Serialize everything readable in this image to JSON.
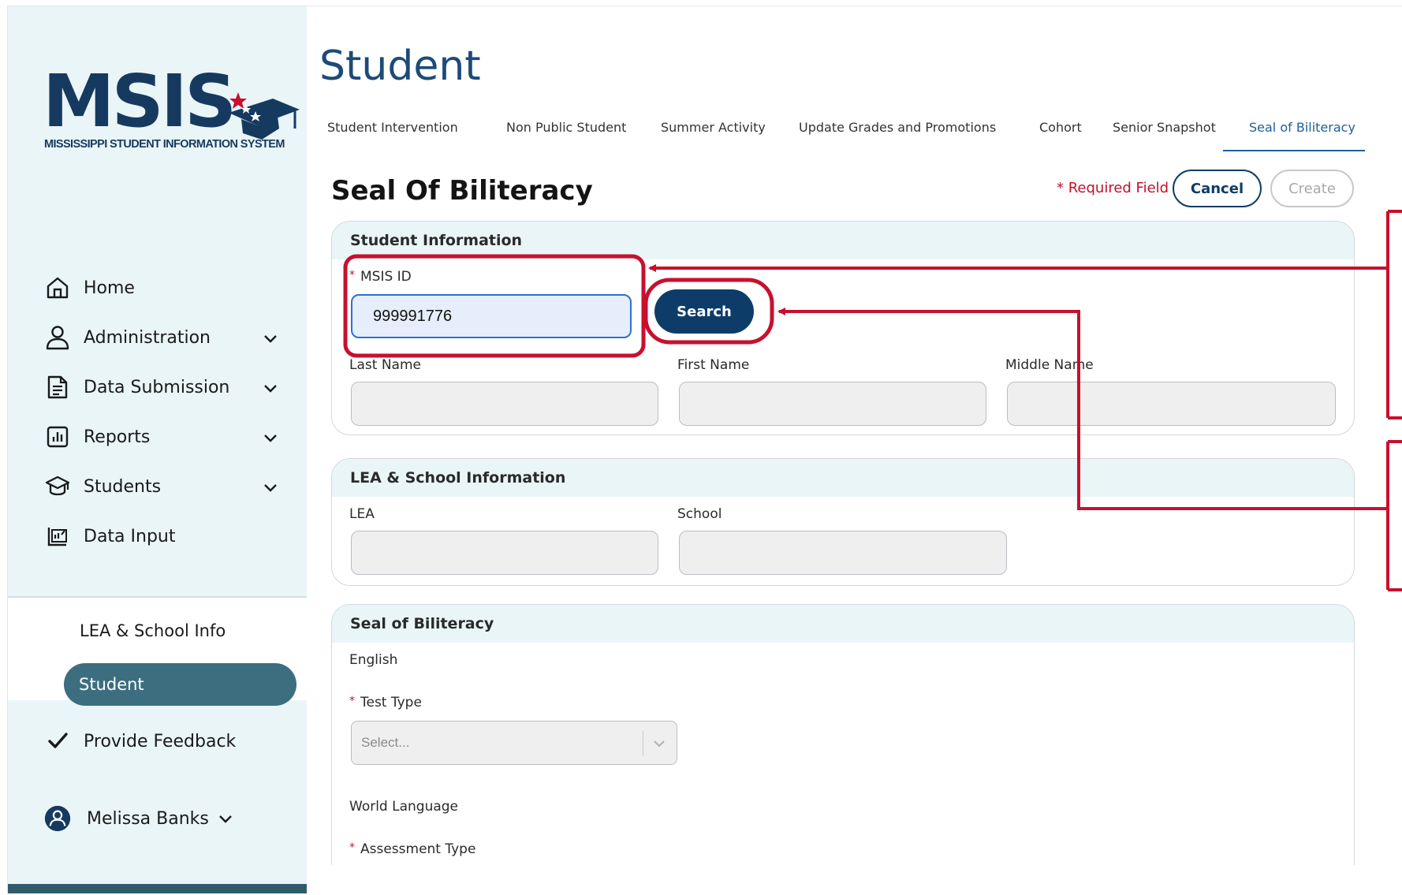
{
  "logo": {
    "word": "MSIS",
    "subtitle": "MISSISSIPPI STUDENT INFORMATION SYSTEM"
  },
  "sidebar": {
    "items": [
      {
        "label": "Home",
        "icon": "home-icon"
      },
      {
        "label": "Administration",
        "icon": "user-icon"
      },
      {
        "label": "Data Submission",
        "icon": "document-icon"
      },
      {
        "label": "Reports",
        "icon": "bar-chart-icon"
      },
      {
        "label": "Students",
        "icon": "graduation-cap-icon"
      },
      {
        "label": "Data Input",
        "icon": "data-input-icon"
      }
    ],
    "sub_items": [
      {
        "label": "LEA & School Info"
      },
      {
        "label": "Student"
      }
    ],
    "feedback": "Provide Feedback",
    "user": "Melissa Banks"
  },
  "page": {
    "title": "Student"
  },
  "tabs": [
    "Student Intervention",
    "Non Public Student",
    "Summer Activity",
    "Update Grades and Promotions",
    "Cohort",
    "Senior Snapshot",
    "Seal of Biliteracy"
  ],
  "form": {
    "title": "Seal Of Biliteracy",
    "required_note": "* Required Field",
    "cancel": "Cancel",
    "create": "Create"
  },
  "student_info": {
    "header": "Student Information",
    "msis_label": "MSIS ID",
    "msis_value": "999991776",
    "search": "Search",
    "last_name": "Last Name",
    "first_name": "First Name",
    "middle_name": "Middle Name"
  },
  "lea_info": {
    "header": "LEA & School Information",
    "lea": "LEA",
    "school": "School"
  },
  "seal": {
    "header": "Seal of Biliteracy",
    "english": "English",
    "test_type": "Test Type",
    "select_placeholder": "Select...",
    "world_language": "World Language",
    "assessment_type": "Assessment Type"
  },
  "colors": {
    "brand_navy": "#0e3c68",
    "title_blue": "#1d4a78",
    "sidebar_bg": "#eaf5f8",
    "active_pill": "#3c6e80",
    "annotation_red": "#c8102e"
  }
}
